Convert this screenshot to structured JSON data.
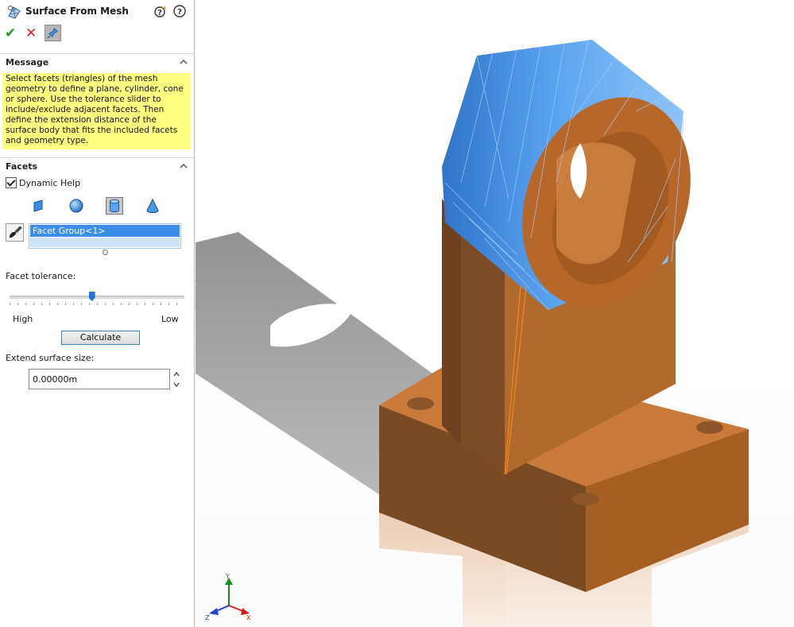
{
  "panel": {
    "title": "Surface From Mesh",
    "title_icon": "surface-from-mesh-icon",
    "help_icon": "help-icon",
    "dynamic_help_icon": "help-star-icon",
    "actions": {
      "ok_label": "✔",
      "cancel_label": "✕",
      "pin_icon": "pushpin-icon"
    },
    "message": {
      "header": "Message",
      "text": "Select facets (triangles) of the mesh geometry to define a plane, cylinder, cone or sphere.  Use the tolerance slider to include/exclude adjacent facets.  Then define the extension distance of the surface body that fits the included facets and geometry type.",
      "background": "#ffff80"
    },
    "facets": {
      "header": "Facets",
      "dynamic_help_label": "Dynamic Help",
      "dynamic_help_checked": true,
      "geometry_types": [
        {
          "name": "plane",
          "icon": "plane-icon",
          "selected": false
        },
        {
          "name": "sphere",
          "icon": "sphere-icon",
          "selected": false
        },
        {
          "name": "cylinder",
          "icon": "cylinder-icon",
          "selected": true
        },
        {
          "name": "cone",
          "icon": "cone-icon",
          "selected": false
        }
      ],
      "paint_icon": "paint-brush-icon",
      "selection_list": [
        "Facet Group<1>"
      ],
      "tolerance_label": "Facet tolerance:",
      "tolerance_high": "High",
      "tolerance_low": "Low",
      "tolerance_value": 0.47,
      "calculate_label": "Calculate",
      "extend_label": "Extend surface size:",
      "extend_value": "0.00000m"
    }
  },
  "viewport": {
    "part_color": "#c8722e",
    "facet_highlight": "#4a95e3",
    "triad": {
      "x": "X",
      "y": "Y",
      "z": "Z"
    }
  }
}
